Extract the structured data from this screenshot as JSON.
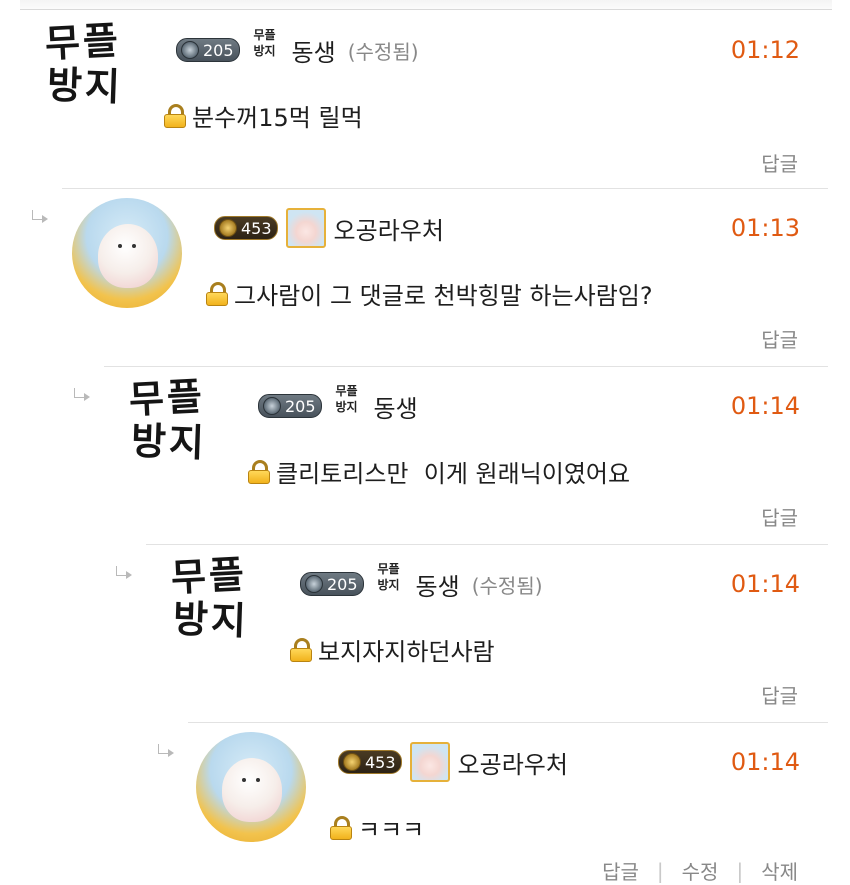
{
  "comments": [
    {
      "level": 0,
      "avatar_type": "calligraphy",
      "avatar_text": [
        "무플",
        "방지"
      ],
      "badge_icon": "gray-gem-badge",
      "badge_level": "205",
      "mini_avatar_text": [
        "무플",
        "방지"
      ],
      "nickname": "동생",
      "edited": "(수정됨)",
      "time": "01:12",
      "message": "분수꺼15먹 릴먹",
      "actions": [
        "답글"
      ]
    },
    {
      "level": 1,
      "avatar_type": "rabbit",
      "badge_icon": "gold-gem-badge",
      "badge_level": "453",
      "nickname": "오공라우처",
      "edited": "",
      "time": "01:13",
      "message": "그사람이 그 댓글로 천박힝말 하는사람임?",
      "actions": [
        "답글"
      ]
    },
    {
      "level": 2,
      "avatar_type": "calligraphy",
      "avatar_text": [
        "무플",
        "방지"
      ],
      "badge_icon": "gray-gem-badge",
      "badge_level": "205",
      "mini_avatar_text": [
        "무플",
        "방지"
      ],
      "nickname": "동생",
      "edited": "",
      "time": "01:14",
      "message": "클리토리스만  이게 원래닉이였어요",
      "actions": [
        "답글"
      ]
    },
    {
      "level": 3,
      "avatar_type": "calligraphy",
      "avatar_text": [
        "무플",
        "방지"
      ],
      "badge_icon": "gray-gem-badge",
      "badge_level": "205",
      "mini_avatar_text": [
        "무플",
        "방지"
      ],
      "nickname": "동생",
      "edited": "(수정됨)",
      "time": "01:14",
      "message": "보지자지하던사람",
      "actions": [
        "답글"
      ]
    },
    {
      "level": 4,
      "avatar_type": "rabbit",
      "badge_icon": "gold-gem-badge",
      "badge_level": "453",
      "nickname": "오공라우처",
      "edited": "",
      "time": "01:14",
      "message": "ㅋㅋㅋ",
      "actions": [
        "답글",
        "수정",
        "삭제"
      ]
    }
  ],
  "colors": {
    "time": "#e05a12",
    "action": "#888888",
    "separator": "#e2e2e2",
    "lock": "#f1b21c"
  },
  "icons": {
    "secret": "lock-icon",
    "reply_indent": "reply-arrow-icon"
  }
}
